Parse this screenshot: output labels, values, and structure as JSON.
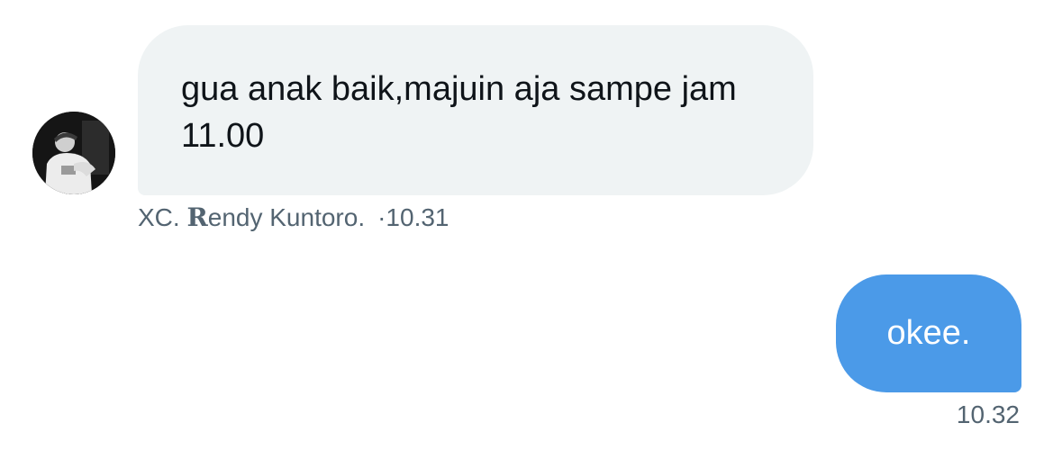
{
  "conversation": {
    "incoming": {
      "message": "gua anak baik,majuin aja sampe jam 11.00",
      "sender_prefix": "XC. ",
      "sender_initial": "R",
      "sender_rest": "endy Kuntoro.",
      "separator": "·",
      "time": "10.31"
    },
    "outgoing": {
      "message": "okee.",
      "time": "10.32"
    }
  },
  "colors": {
    "incoming_bubble": "#eff3f4",
    "outgoing_bubble": "#4b9ae8",
    "meta_text": "#536471"
  },
  "icons": {
    "avatar": "user-profile-photo"
  }
}
